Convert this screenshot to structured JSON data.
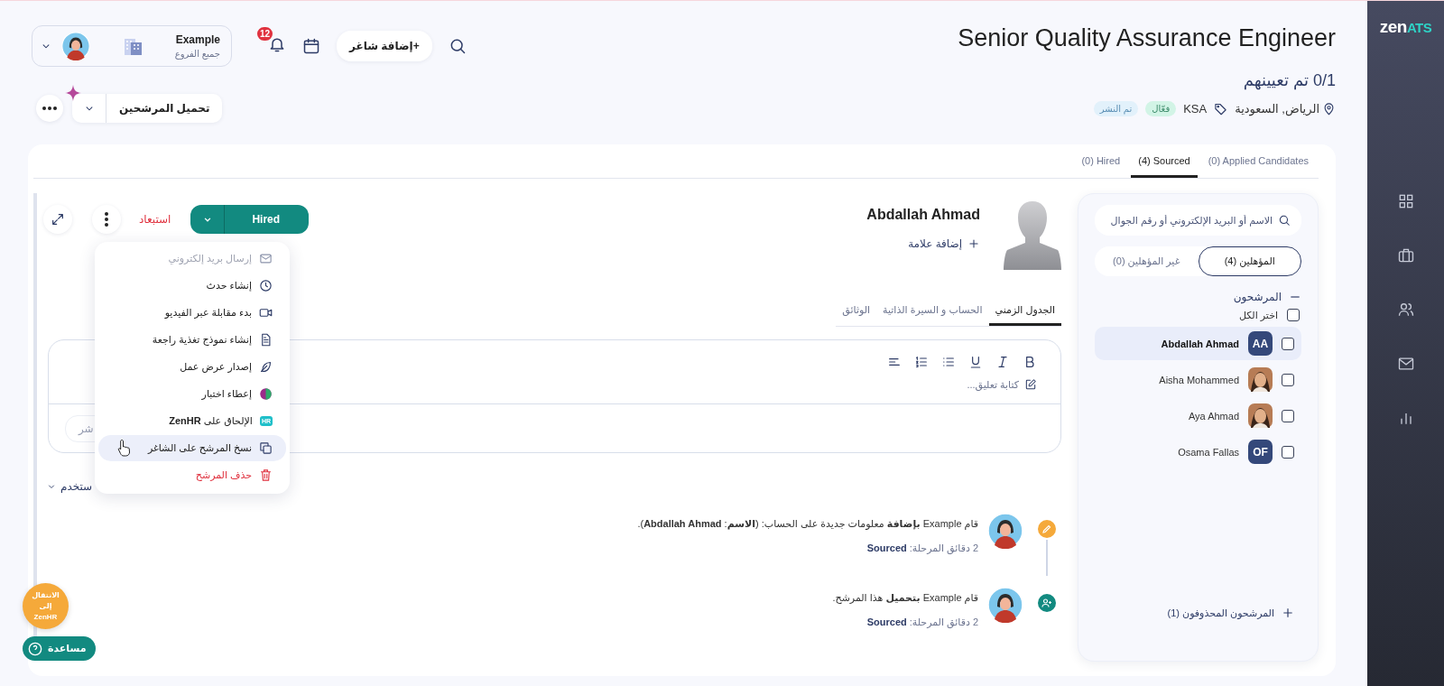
{
  "logo": {
    "first": "zen",
    "second": "ATS"
  },
  "header": {
    "add_job": "+إضافة شاغر",
    "notifications": "12",
    "account": {
      "name": "Example",
      "branch": "جميع الفروع"
    },
    "upload": "تحميل المرشحين"
  },
  "job": {
    "title": "Senior Quality Assurance Engineer",
    "hired": "0/1 تم تعيينهم",
    "location": "الرياض, السعودية",
    "tag": "KSA",
    "badges": [
      {
        "label": "فعّال",
        "color": "#d2f4e6"
      },
      {
        "label": "تم النشر",
        "color": "#e2f1fb"
      }
    ]
  },
  "stage_tabs": [
    {
      "label": "(0) Applied Candidates",
      "selected": false
    },
    {
      "label": "(4) Sourced",
      "selected": true
    },
    {
      "label": "(0) Hired",
      "selected": false
    }
  ],
  "profile": {
    "name": "Abdallah Ahmad",
    "add_tag": "إضافة علامة",
    "stage": "Hired",
    "reject": "استبعاد",
    "tabs": [
      {
        "label": "الجدول الزمني",
        "selected": true
      },
      {
        "label": "الحساب و السيرة الذاتية",
        "selected": false
      },
      {
        "label": "الوثائق",
        "selected": false
      }
    ],
    "comment_placeholder": "كتابة تعليق...",
    "field_text": "شر",
    "history_toggle": "ستخدم"
  },
  "menu": [
    {
      "label": "إرسال بريد إلكتروني",
      "kind": "normal",
      "disabled": true,
      "selected": false
    },
    {
      "label": "إنشاء حدث",
      "kind": "normal",
      "disabled": false,
      "selected": false
    },
    {
      "label": "بدء مقابلة عبر الفيديو",
      "kind": "normal",
      "disabled": false,
      "selected": false
    },
    {
      "label": "إنشاء نموذج تغذية راجعة",
      "kind": "normal",
      "disabled": false,
      "selected": false
    },
    {
      "label": "إصدار عرض عمل",
      "kind": "normal",
      "disabled": false,
      "selected": false
    },
    {
      "label": "إعطاء اختبار",
      "kind": "normal",
      "disabled": false,
      "selected": false
    },
    {
      "label": "الإلحاق على **ZenHR**",
      "kind": "normal",
      "disabled": false,
      "selected": false,
      "badge": "HR"
    },
    {
      "label": "نسخ المرشح على الشاغر",
      "kind": "normal",
      "disabled": false,
      "selected": true
    },
    {
      "label": "حذف المرشح",
      "kind": "danger",
      "disabled": false,
      "selected": false
    }
  ],
  "timeline": [
    {
      "kind": "edit",
      "text": "قام Example **بإضافة** معلومات جديدة على الحساب: (**الاسم**: **Abdallah Ahmad**).",
      "meta": "2 دقائق المرحلة: **Sourced**"
    },
    {
      "kind": "upload",
      "text": "قام Example **بتحميل** هذا المرشح.",
      "meta": "2 دقائق المرحلة: **Sourced**"
    }
  ],
  "candidates_panel": {
    "search_placeholder": "الاسم أو البريد الإلكتروني أو رقم الجوال",
    "filters": [
      {
        "label": "المؤهلين (4)",
        "selected": true
      },
      {
        "label": "غير المؤهلين (0)",
        "selected": false
      }
    ],
    "group": {
      "title": "المرشحون",
      "expanded": true
    },
    "select_all": {
      "label": "اختر الكل",
      "checked": false
    },
    "candidates": [
      {
        "name": "Abdallah Ahmad",
        "kind": "initials",
        "initials": "AA",
        "selected": true,
        "checked": false
      },
      {
        "name": "Aisha Mohammed",
        "selected": false,
        "checked": false
      },
      {
        "name": "Aya Ahmad",
        "selected": false,
        "checked": false
      },
      {
        "name": "Osama Fallas",
        "kind": "initials",
        "initials": "OF",
        "selected": false,
        "checked": false
      }
    ],
    "deleted": {
      "title": "المرشحون المحذوفون (1)",
      "expanded": false
    }
  },
  "floating": {
    "zenhr": "الانتقال إلى ZenHR",
    "help": "مساعدة"
  }
}
